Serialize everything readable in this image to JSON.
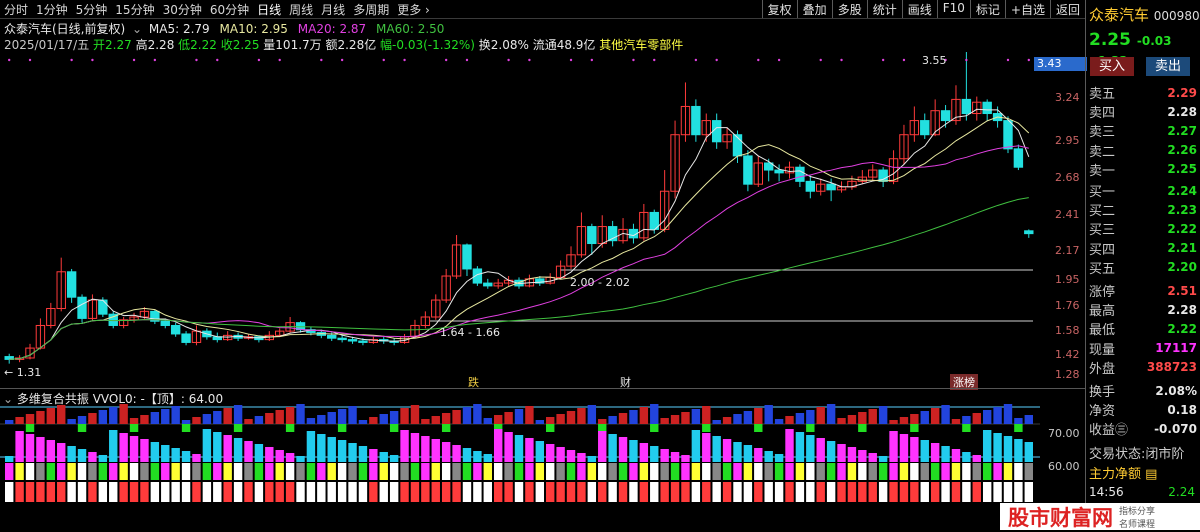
{
  "toolbar": {
    "periods": [
      "分时",
      "1分钟",
      "5分钟",
      "15分钟",
      "30分钟",
      "60分钟",
      "日线",
      "周线",
      "月线",
      "多周期",
      "更多 ›"
    ],
    "tools": [
      "复权",
      "叠加",
      "多股",
      "统计",
      "画线",
      "F10",
      "标记",
      "+自选",
      "返回"
    ]
  },
  "chart_title": {
    "stock": "众泰汽车(日线,前复权)",
    "ma5": "MA5: 2.79",
    "ma10": "MA10: 2.95",
    "ma20": "MA20: 2.87",
    "ma60": "MA60: 2.50"
  },
  "bar_info": {
    "date": "2025/01/17/五",
    "open": "开2.27",
    "high": "高2.28",
    "low": "低2.22",
    "close": "收2.25",
    "volume": "量101.7万",
    "amount": "额2.28亿",
    "change": "幅-0.03(-1.32%)",
    "turnover": "换2.08%",
    "float": "流通48.9亿",
    "sector": "其他汽车零部件"
  },
  "price_axis": [
    "3.24",
    "2.95",
    "2.68",
    "2.41",
    "2.17",
    "1.95",
    "1.76",
    "1.58",
    "1.42",
    "1.28"
  ],
  "price_box": "3.43",
  "annotations": {
    "high_mark": "3.55",
    "low_mark": "1.31",
    "gap1": "2.00 - 2.02",
    "gap2": "1.64 - 1.66",
    "events": [
      "跌",
      "财",
      "涨榜"
    ]
  },
  "indicator": {
    "title": "多维复合共振 VVOL0: -【顶】: 64.00",
    "axis": [
      "70.00",
      "60.00"
    ]
  },
  "colors": {
    "up": "#ff3b3b",
    "down": "#22e0e0",
    "ma5": "#e8e8e8",
    "ma10": "#e8e8a0",
    "ma20": "#e040e0",
    "ma60": "#40c040"
  },
  "chart_data": {
    "type": "candlestick",
    "price_range": [
      1.2,
      3.5
    ],
    "candles": [
      [
        1.38,
        1.36,
        1.4,
        1.33
      ],
      [
        1.36,
        1.37,
        1.39,
        1.34
      ],
      [
        1.37,
        1.44,
        1.47,
        1.36
      ],
      [
        1.44,
        1.6,
        1.65,
        1.43
      ],
      [
        1.6,
        1.72,
        1.76,
        1.58
      ],
      [
        1.72,
        1.98,
        2.08,
        1.7
      ],
      [
        1.98,
        1.8,
        2.0,
        1.76
      ],
      [
        1.8,
        1.65,
        1.82,
        1.62
      ],
      [
        1.65,
        1.78,
        1.82,
        1.63
      ],
      [
        1.78,
        1.68,
        1.8,
        1.66
      ],
      [
        1.68,
        1.6,
        1.7,
        1.58
      ],
      [
        1.6,
        1.64,
        1.66,
        1.58
      ],
      [
        1.64,
        1.66,
        1.69,
        1.62
      ],
      [
        1.66,
        1.7,
        1.73,
        1.64
      ],
      [
        1.7,
        1.63,
        1.71,
        1.61
      ],
      [
        1.63,
        1.6,
        1.65,
        1.58
      ],
      [
        1.6,
        1.54,
        1.62,
        1.52
      ],
      [
        1.54,
        1.48,
        1.56,
        1.46
      ],
      [
        1.48,
        1.56,
        1.6,
        1.46
      ],
      [
        1.56,
        1.52,
        1.58,
        1.5
      ],
      [
        1.52,
        1.5,
        1.55,
        1.48
      ],
      [
        1.5,
        1.53,
        1.56,
        1.49
      ],
      [
        1.53,
        1.51,
        1.55,
        1.49
      ],
      [
        1.51,
        1.52,
        1.54,
        1.5
      ],
      [
        1.52,
        1.5,
        1.53,
        1.48
      ],
      [
        1.5,
        1.53,
        1.56,
        1.49
      ],
      [
        1.53,
        1.56,
        1.58,
        1.52
      ],
      [
        1.56,
        1.62,
        1.66,
        1.55
      ],
      [
        1.62,
        1.57,
        1.63,
        1.55
      ],
      [
        1.57,
        1.55,
        1.59,
        1.53
      ],
      [
        1.55,
        1.53,
        1.57,
        1.51
      ],
      [
        1.53,
        1.51,
        1.55,
        1.49
      ],
      [
        1.51,
        1.5,
        1.53,
        1.48
      ],
      [
        1.5,
        1.49,
        1.52,
        1.47
      ],
      [
        1.49,
        1.48,
        1.51,
        1.46
      ],
      [
        1.48,
        1.5,
        1.52,
        1.47
      ],
      [
        1.5,
        1.49,
        1.52,
        1.47
      ],
      [
        1.49,
        1.48,
        1.51,
        1.46
      ],
      [
        1.48,
        1.52,
        1.54,
        1.47
      ],
      [
        1.52,
        1.6,
        1.64,
        1.51
      ],
      [
        1.6,
        1.66,
        1.7,
        1.58
      ],
      [
        1.66,
        1.78,
        1.82,
        1.64
      ],
      [
        1.78,
        1.95,
        2.0,
        1.76
      ],
      [
        1.95,
        2.17,
        2.24,
        1.93
      ],
      [
        2.17,
        2.0,
        2.18,
        1.95
      ],
      [
        2.0,
        1.9,
        2.02,
        1.88
      ],
      [
        1.9,
        1.88,
        1.93,
        1.86
      ],
      [
        1.88,
        1.9,
        1.93,
        1.86
      ],
      [
        1.9,
        1.92,
        1.95,
        1.88
      ],
      [
        1.92,
        1.88,
        1.94,
        1.86
      ],
      [
        1.88,
        1.93,
        1.96,
        1.87
      ],
      [
        1.93,
        1.9,
        1.95,
        1.88
      ],
      [
        1.9,
        1.94,
        1.97,
        1.89
      ],
      [
        1.94,
        2.02,
        2.06,
        1.93
      ],
      [
        2.02,
        2.1,
        2.16,
        2.0
      ],
      [
        2.1,
        2.3,
        2.4,
        2.08
      ],
      [
        2.3,
        2.18,
        2.32,
        2.1
      ],
      [
        2.18,
        2.3,
        2.38,
        2.15
      ],
      [
        2.3,
        2.2,
        2.34,
        2.16
      ],
      [
        2.2,
        2.28,
        2.36,
        2.18
      ],
      [
        2.28,
        2.22,
        2.32,
        2.18
      ],
      [
        2.22,
        2.4,
        2.46,
        2.2
      ],
      [
        2.4,
        2.28,
        2.42,
        2.25
      ],
      [
        2.28,
        2.55,
        2.7,
        2.26
      ],
      [
        2.55,
        2.95,
        3.05,
        2.5
      ],
      [
        2.95,
        3.15,
        3.32,
        2.9
      ],
      [
        3.15,
        2.95,
        3.2,
        2.9
      ],
      [
        2.95,
        3.05,
        3.1,
        2.9
      ],
      [
        3.05,
        2.9,
        3.1,
        2.85
      ],
      [
        2.9,
        2.95,
        3.0,
        2.85
      ],
      [
        2.95,
        2.8,
        2.98,
        2.75
      ],
      [
        2.8,
        2.6,
        2.84,
        2.55
      ],
      [
        2.6,
        2.75,
        2.8,
        2.58
      ],
      [
        2.75,
        2.7,
        2.78,
        2.62
      ],
      [
        2.7,
        2.68,
        2.74,
        2.62
      ],
      [
        2.68,
        2.72,
        2.76,
        2.64
      ],
      [
        2.72,
        2.62,
        2.74,
        2.58
      ],
      [
        2.62,
        2.55,
        2.66,
        2.5
      ],
      [
        2.55,
        2.6,
        2.64,
        2.52
      ],
      [
        2.6,
        2.56,
        2.64,
        2.48
      ],
      [
        2.56,
        2.58,
        2.62,
        2.54
      ],
      [
        2.58,
        2.62,
        2.66,
        2.56
      ],
      [
        2.62,
        2.65,
        2.7,
        2.6
      ],
      [
        2.65,
        2.7,
        2.74,
        2.62
      ],
      [
        2.7,
        2.62,
        2.72,
        2.58
      ],
      [
        2.62,
        2.78,
        2.84,
        2.6
      ],
      [
        2.78,
        2.95,
        3.02,
        2.74
      ],
      [
        2.95,
        3.05,
        3.15,
        2.9
      ],
      [
        3.05,
        2.95,
        3.1,
        2.92
      ],
      [
        2.95,
        3.12,
        3.2,
        2.94
      ],
      [
        3.12,
        3.05,
        3.16,
        3.0
      ],
      [
        3.05,
        3.2,
        3.3,
        3.02
      ],
      [
        3.2,
        3.1,
        3.55,
        3.05
      ],
      [
        3.1,
        3.18,
        3.22,
        3.05
      ],
      [
        3.18,
        3.1,
        3.2,
        3.05
      ],
      [
        3.1,
        3.05,
        3.15,
        3.0
      ],
      [
        3.05,
        2.85,
        3.08,
        2.82
      ],
      [
        2.85,
        2.72,
        2.88,
        2.7
      ],
      [
        2.27,
        2.25,
        2.28,
        2.22
      ]
    ]
  }
}
